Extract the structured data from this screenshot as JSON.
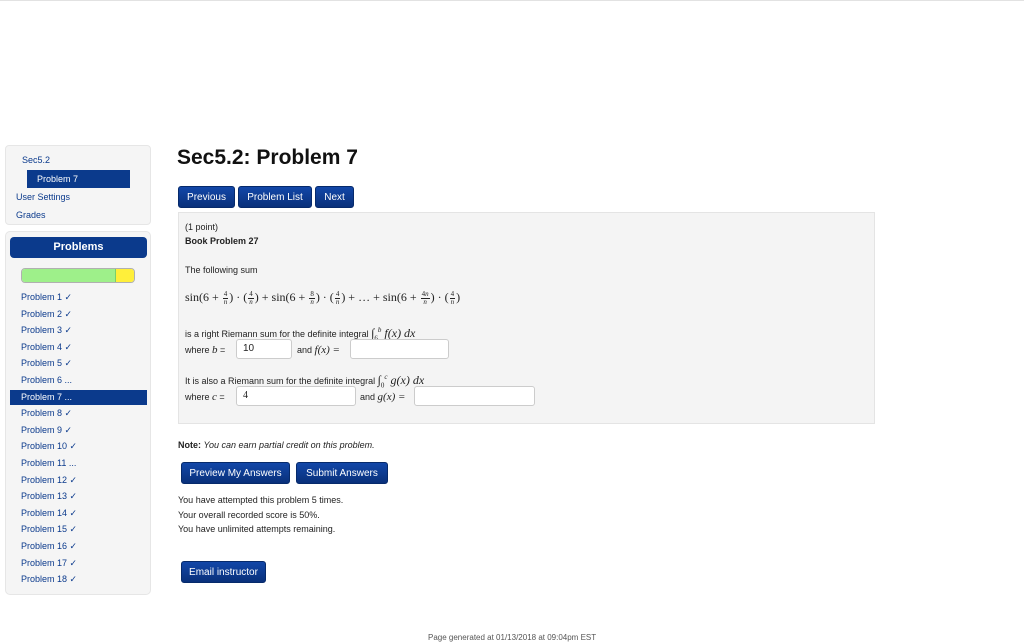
{
  "breadcrumb": {
    "section": "Sec5.2",
    "current": "Problem 7",
    "links": [
      "User Settings",
      "Grades"
    ]
  },
  "sidebar": {
    "problems_header": "Problems",
    "progress": {
      "correct_fraction": 0.83,
      "partial_fraction": 0.17,
      "correct_color": "#9ef08a",
      "partial_color": "#ffef3a"
    },
    "problems": [
      {
        "label": "Problem 1 ✓",
        "active": false
      },
      {
        "label": "Problem 2 ✓",
        "active": false
      },
      {
        "label": "Problem 3 ✓",
        "active": false
      },
      {
        "label": "Problem 4 ✓",
        "active": false
      },
      {
        "label": "Problem 5 ✓",
        "active": false
      },
      {
        "label": "Problem 6 ...",
        "active": false
      },
      {
        "label": "Problem 7 ...",
        "active": true
      },
      {
        "label": "Problem 8 ✓",
        "active": false
      },
      {
        "label": "Problem 9 ✓",
        "active": false
      },
      {
        "label": "Problem 10 ✓",
        "active": false
      },
      {
        "label": "Problem 11 ...",
        "active": false
      },
      {
        "label": "Problem 12 ✓",
        "active": false
      },
      {
        "label": "Problem 13 ✓",
        "active": false
      },
      {
        "label": "Problem 14 ✓",
        "active": false
      },
      {
        "label": "Problem 15 ✓",
        "active": false
      },
      {
        "label": "Problem 16 ✓",
        "active": false
      },
      {
        "label": "Problem 17 ✓",
        "active": false
      },
      {
        "label": "Problem 18 ✓",
        "active": false
      }
    ]
  },
  "main": {
    "title": "Sec5.2: Problem 7",
    "nav_buttons": {
      "previous": "Previous",
      "problem_list": "Problem List",
      "next": "Next"
    },
    "problem": {
      "points": "(1 point)",
      "book_problem": "Book Problem 27",
      "intro": "The following sum",
      "line1": "is a right Riemann sum for the definite integral",
      "where_b": "where",
      "b_var": "b",
      "b_value": "10",
      "and_f": "and",
      "f_label": "f(x) =",
      "f_value": "",
      "line2": "It is also a Riemann sum for the definite integral",
      "where_c": "where",
      "c_var": "c",
      "c_value": "4",
      "and_g": "and",
      "g_label": "g(x) =",
      "g_value": "",
      "integral1": {
        "lower": "6",
        "upper": "b",
        "integrand": "f(x) dx"
      },
      "integral2": {
        "lower": "0",
        "upper": "c",
        "integrand": "g(x) dx"
      }
    },
    "note_label": "Note:",
    "note_text": "You can earn partial credit on this problem.",
    "buttons": {
      "preview": "Preview My Answers",
      "submit": "Submit Answers",
      "email": "Email instructor"
    },
    "status": [
      "You have attempted this problem 5 times.",
      "Your overall recorded score is 50%.",
      "You have unlimited attempts remaining."
    ]
  },
  "footer": "Page generated at 01/13/2018 at 09:04pm EST"
}
